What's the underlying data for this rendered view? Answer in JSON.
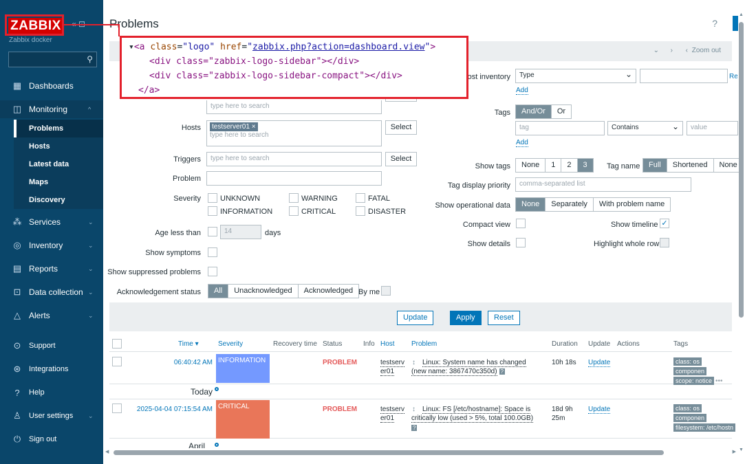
{
  "sidebar": {
    "logo": "ZABBIX",
    "server_name": "Zabbix docker",
    "collapse_icons": "«  ⊡",
    "nav": [
      {
        "label": "Dashboards",
        "icon": "dashboard-icon",
        "glyph": "▦"
      },
      {
        "label": "Monitoring",
        "icon": "monitoring-icon",
        "glyph": "◫"
      },
      {
        "label": "Services",
        "icon": "services-icon",
        "glyph": "⁂"
      },
      {
        "label": "Inventory",
        "icon": "inventory-icon",
        "glyph": "◎"
      },
      {
        "label": "Reports",
        "icon": "reports-icon",
        "glyph": "▤"
      },
      {
        "label": "Data collection",
        "icon": "data-collection-icon",
        "glyph": "⊡"
      },
      {
        "label": "Alerts",
        "icon": "alerts-icon",
        "glyph": "△"
      }
    ],
    "monitoring_sub": [
      "Problems",
      "Hosts",
      "Latest data",
      "Maps",
      "Discovery"
    ],
    "lower": [
      {
        "label": "Support",
        "icon": "support-icon",
        "glyph": "⊙"
      },
      {
        "label": "Integrations",
        "icon": "integrations-icon",
        "glyph": "⊛"
      },
      {
        "label": "Help",
        "icon": "help-icon",
        "glyph": "?"
      },
      {
        "label": "User settings",
        "icon": "user-icon",
        "glyph": "♙"
      },
      {
        "label": "Sign out",
        "icon": "power-icon",
        "glyph": "⏻"
      }
    ]
  },
  "header": {
    "title": "Problems",
    "help": "?"
  },
  "filter_tab": {
    "zoom_out": "Zoom out"
  },
  "code_overlay": {
    "line1_tag": "<a",
    "line1_attr1": "class",
    "line1_val1": "\"logo\"",
    "line1_attr2": "href",
    "line1_val2": "zabbix.php?action=dashboard.view",
    "line1_end": ">",
    "line2": "<div class=\"zabbix-logo-sidebar\"></div>",
    "line3": "<div class=\"zabbix-logo-sidebar-compact\"></div>",
    "line4": "</a>"
  },
  "filter": {
    "type_here": "type here to search",
    "hosts_label": "Hosts",
    "host_tag": "testserver01 ×",
    "select": "Select",
    "triggers_label": "Triggers",
    "problem_label": "Problem",
    "severity_label": "Severity",
    "severities": [
      "UNKNOWN",
      "INFORMATION",
      "WARNING",
      "CRITICAL",
      "FATAL",
      "DISASTER"
    ],
    "age_label": "Age less than",
    "age_value": "14",
    "days": "days",
    "show_symptoms": "Show symptoms",
    "show_suppressed": "Show suppressed problems",
    "ack_label": "Acknowledgement status",
    "ack_options": [
      "All",
      "Unacknowledged",
      "Acknowledged"
    ],
    "by_me": "By me",
    "host_inventory_label": "Host inventory",
    "inventory_type": "Type",
    "add": "Add",
    "re": "Re",
    "tags_label": "Tags",
    "tags_ops": [
      "And/Or",
      "Or"
    ],
    "tag_placeholder": "tag",
    "contains": "Contains",
    "value_placeholder": "value",
    "show_tags_label": "Show tags",
    "show_tags_opts": [
      "None",
      "1",
      "2",
      "3"
    ],
    "tag_name_label": "Tag name",
    "tag_name_opts": [
      "Full",
      "Shortened",
      "None"
    ],
    "tag_priority_label": "Tag display priority",
    "tag_priority_placeholder": "comma-separated list",
    "show_opdata_label": "Show operational data",
    "opdata_opts": [
      "None",
      "Separately",
      "With problem name"
    ],
    "compact_view": "Compact view",
    "show_timeline": "Show timeline",
    "show_details": "Show details",
    "highlight_row": "Highlight whole row",
    "update": "Update",
    "apply": "Apply",
    "reset": "Reset"
  },
  "table": {
    "headers": [
      "Time ▾",
      "Severity",
      "Recovery time",
      "Status",
      "Info",
      "Host",
      "Problem",
      "Duration",
      "Update",
      "Actions",
      "Tags"
    ],
    "rows": [
      {
        "time": "06:40:42 AM",
        "severity": "INFORMATION",
        "sev_color": "#7499ff",
        "status": "PROBLEM",
        "host1": "testserv",
        "host2": "er01",
        "problem1": "Linux: System name has changed",
        "problem2": "(new name: 3867470c350d)",
        "duration": "10h 18s",
        "update": "Update",
        "tags": [
          "class: os",
          "componen",
          "scope: notice"
        ]
      },
      {
        "time": "2025-04-04 07:15:54 AM",
        "severity": "CRITICAL",
        "sev_color": "#e97659",
        "status": "PROBLEM",
        "host1": "testserv",
        "host2": "er01",
        "problem1": "Linux: FS [/etc/hostname]: Space is",
        "problem2": "critically low (used > 5%, total 100.0GB)",
        "duration1": "18d 9h",
        "duration2": "25m",
        "update": "Update",
        "tags": [
          "class: os",
          "componen",
          "filesystem: /etc/hostn"
        ]
      }
    ],
    "sep_today": "Today",
    "sep_april": "April"
  }
}
